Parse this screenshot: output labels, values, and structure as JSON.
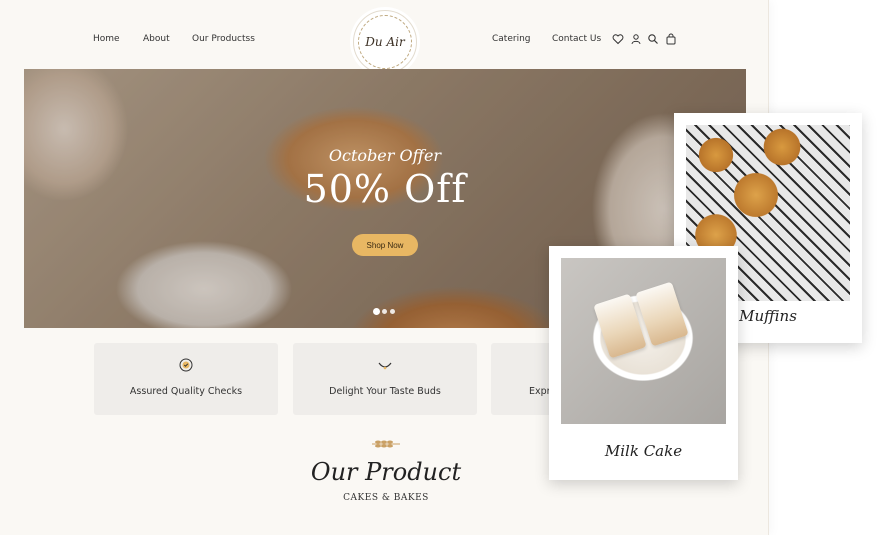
{
  "nav": {
    "left_links": [
      "Home",
      "About",
      "Our Productss"
    ],
    "right_links": [
      "Catering",
      "Contact Us"
    ],
    "logo_text": "Du Air",
    "icons": [
      "heart-icon",
      "user-icon",
      "search-icon",
      "cart-icon"
    ]
  },
  "hero": {
    "offer_label": "October Offer",
    "discount": "50% Off",
    "cta_label": "Shop Now",
    "slides": 3,
    "active_slide": 1
  },
  "features": [
    {
      "label": "Assured Quality Checks",
      "icon": "quality-badge-icon"
    },
    {
      "label": "Delight Your Taste Buds",
      "icon": "smile-icon"
    },
    {
      "label": "Expre",
      "icon": "delivery-icon"
    }
  ],
  "products_section": {
    "title": "Our Product",
    "subtitle": "CAKES & BAKES"
  },
  "cards": [
    {
      "caption": "Muffins"
    },
    {
      "caption": "Milk Cake"
    }
  ],
  "colors": {
    "accent": "#e8b763",
    "page_bg": "#faf8f4",
    "feature_bg": "#efedea"
  }
}
